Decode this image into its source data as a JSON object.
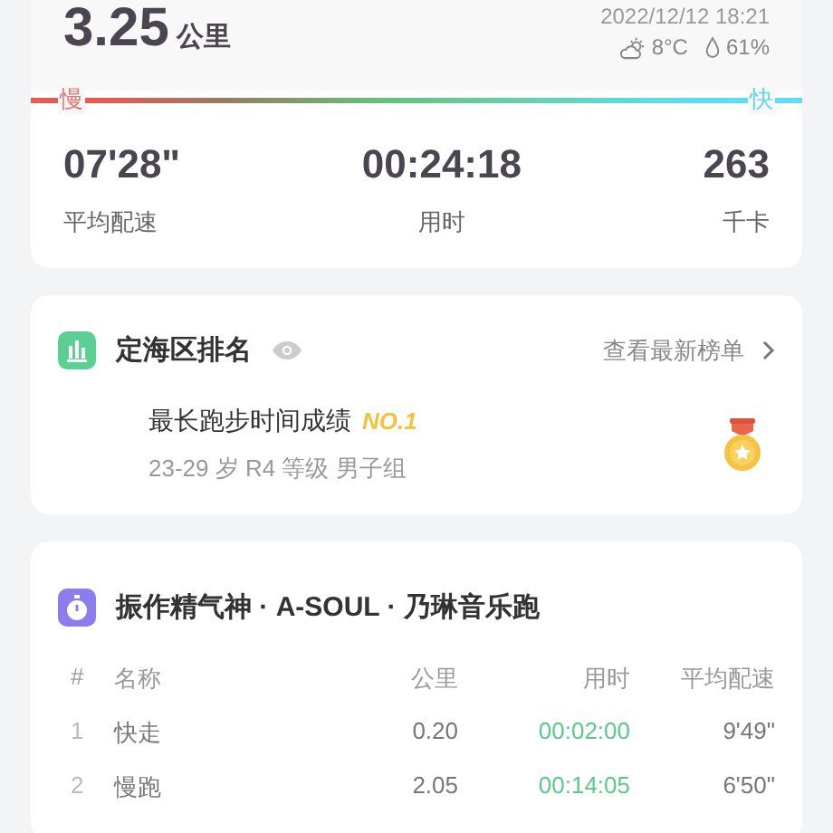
{
  "summary": {
    "distance": "3.25",
    "unit": "公里",
    "datetime": "2022/12/12 18:21",
    "temperature": "8°C",
    "humidity": "61%"
  },
  "pace_bar": {
    "slow_label": "慢",
    "fast_label": "快"
  },
  "stats": [
    {
      "value": "07'28\"",
      "label": "平均配速"
    },
    {
      "value": "00:24:18",
      "label": "用时"
    },
    {
      "value": "263",
      "label": "千卡"
    }
  ],
  "ranking": {
    "title": "定海区排名",
    "link": "查看最新榜单",
    "achievement": "最长跑步时间成绩",
    "rank": "NO.1",
    "group": "23-29 岁 R4 等级 男子组"
  },
  "music_run": {
    "title": "振作精气神 · A-SOUL · 乃琳音乐跑",
    "columns": [
      "#",
      "名称",
      "公里",
      "用时",
      "平均配速"
    ],
    "rows": [
      {
        "index": "1",
        "name": "快走",
        "distance": "0.20",
        "time": "00:02:00",
        "pace": "9'49\""
      },
      {
        "index": "2",
        "name": "慢跑",
        "distance": "2.05",
        "time": "00:14:05",
        "pace": "6'50\""
      }
    ]
  }
}
